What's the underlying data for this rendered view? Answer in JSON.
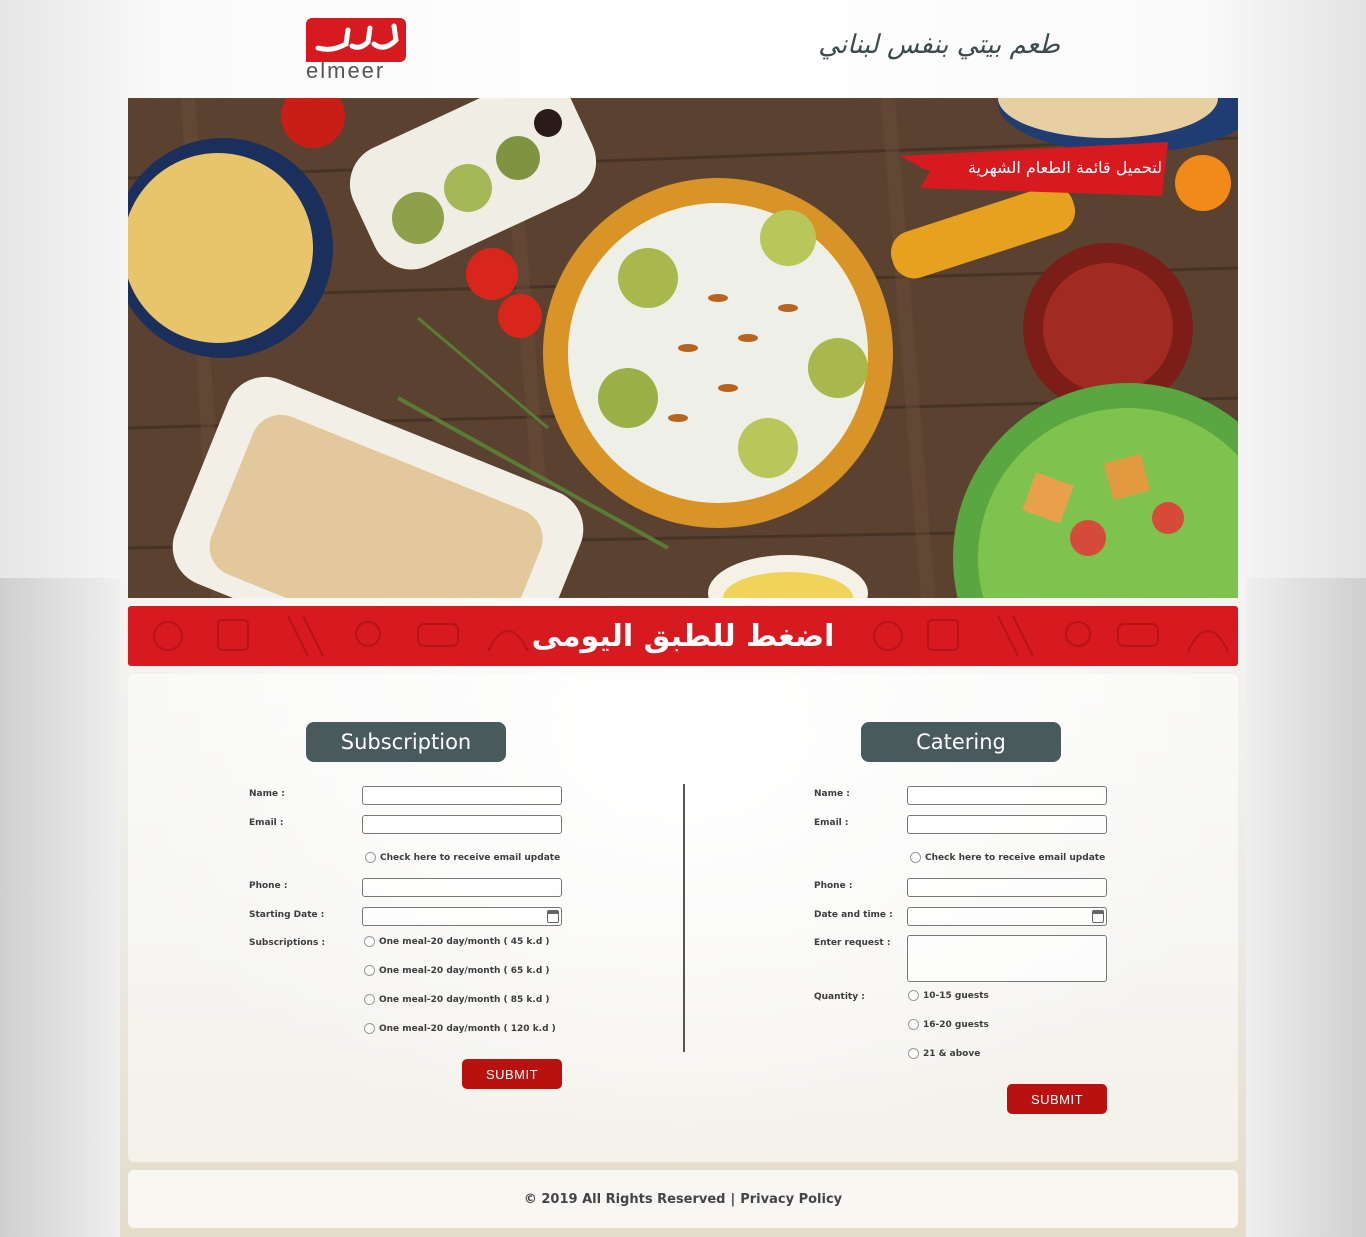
{
  "header": {
    "logo_text": "elmeer",
    "tagline": "طعم بيتي بنفس لبناني"
  },
  "hero": {
    "menu_ribbon": "لتحميل قائمة الطعام الشهرية"
  },
  "daily_dish": {
    "label": "اضغط للطبق اليومى"
  },
  "subscription": {
    "title": "Subscription",
    "name_label": "Name :",
    "email_label": "Email :",
    "email_update_label": "Check here to receive email update",
    "phone_label": "Phone :",
    "start_date_label": "Starting Date :",
    "subscriptions_label": "Subscriptions :",
    "options": [
      "One meal-20 day/month ( 45 k.d )",
      "One meal-20 day/month ( 65 k.d )",
      "One meal-20 day/month ( 85 k.d )",
      "One meal-20 day/month ( 120 k.d )"
    ],
    "submit": "SUBMIT"
  },
  "catering": {
    "title": "Catering",
    "name_label": "Name :",
    "email_label": "Email :",
    "email_update_label": "Check here to receive email update",
    "phone_label": "Phone :",
    "datetime_label": "Date and time :",
    "request_label": "Enter request :",
    "quantity_label": "Quantity :",
    "quantity_options": [
      "10-15 guests",
      "16-20 guests",
      "21 & above"
    ],
    "submit": "SUBMIT"
  },
  "footer": {
    "copyright": "© 2019 All Rights Reserved",
    "separator": "|",
    "privacy": "Privacy Policy"
  },
  "colors": {
    "brand_red": "#d71920",
    "pill_gray": "#485a5c",
    "submit_red": "#b9110f"
  }
}
